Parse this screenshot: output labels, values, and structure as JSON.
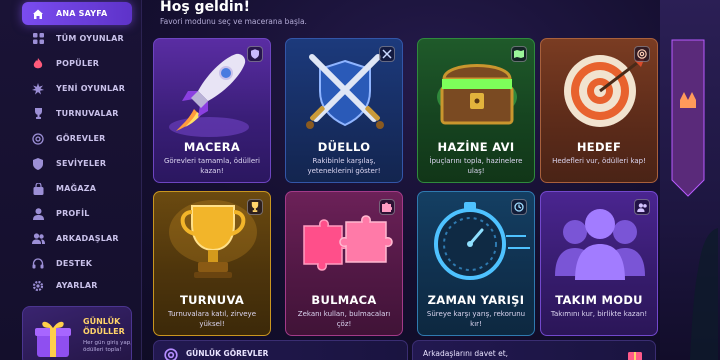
{
  "sidebar": {
    "items": [
      {
        "label": "ANA SAYFA",
        "icon": "home-icon",
        "active": true
      },
      {
        "label": "TÜM OYUNLAR",
        "icon": "grid-icon"
      },
      {
        "label": "POPÜLER",
        "icon": "flame-icon"
      },
      {
        "label": "YENİ OYUNLAR",
        "icon": "burst-icon"
      },
      {
        "label": "TURNUVALAR",
        "icon": "trophy-icon"
      },
      {
        "label": "GÖREVLER",
        "icon": "target-icon"
      },
      {
        "label": "SEVİYELER",
        "icon": "shield-icon"
      },
      {
        "label": "MAĞAZA",
        "icon": "bag-icon"
      },
      {
        "label": "PROFİL",
        "icon": "user-icon"
      },
      {
        "label": "ARKADAŞLAR",
        "icon": "users-icon"
      },
      {
        "label": "DESTEK",
        "icon": "headset-icon"
      },
      {
        "label": "AYARLAR",
        "icon": "gear-icon"
      }
    ],
    "daily_rewards": {
      "title": "GÜNLÜK ÖDÜLLER",
      "subtitle": "Her gün giriş yap, ödülleri topla!",
      "icon": "gift-icon"
    }
  },
  "header": {
    "title": "Hoş geldin!",
    "subtitle": "Favori modunu seç ve macerana başla."
  },
  "modes": [
    {
      "title": "MACERA",
      "description": "Görevleri tamamla, ödülleri kazan!",
      "icon": "rocket-icon",
      "badge_icon": "shield-icon"
    },
    {
      "title": "DÜELLO",
      "description": "Rakibinle karşılaş, yeteneklerini göster!",
      "icon": "crossed-swords-icon",
      "badge_icon": "swords-icon"
    },
    {
      "title": "HAZİNE AVI",
      "description": "İpuçlarını topla, hazinelere ulaş!",
      "icon": "treasure-chest-icon",
      "badge_icon": "map-icon"
    },
    {
      "title": "HEDEF",
      "description": "Hedefleri vur, ödülleri kap!",
      "icon": "archery-target-icon",
      "badge_icon": "target-icon"
    },
    {
      "title": "TURNUVA",
      "description": "Turnuvalara katıl, zirveye yüksel!",
      "icon": "trophy-icon",
      "badge_icon": "trophy-icon"
    },
    {
      "title": "BULMACA",
      "description": "Zekanı kullan, bulmacaları çöz!",
      "icon": "puzzle-icon",
      "badge_icon": "puzzle-icon"
    },
    {
      "title": "ZAMAN YARIŞI",
      "description": "Süreye karşı yarış, rekorunu kır!",
      "icon": "stopwatch-icon",
      "badge_icon": "clock-icon"
    },
    {
      "title": "TAKIM MODU",
      "description": "Takımını kur, birlikte kazan!",
      "icon": "team-icon",
      "badge_icon": "users-icon"
    }
  ],
  "bottom": {
    "daily_tasks": "GÜNLÜK GÖREVLER",
    "invite_text": "Arkadaşlarını davet et,"
  },
  "colors": {
    "accent": "#7a4cf0",
    "background": "#150f30",
    "gold": "#ffd36a"
  }
}
